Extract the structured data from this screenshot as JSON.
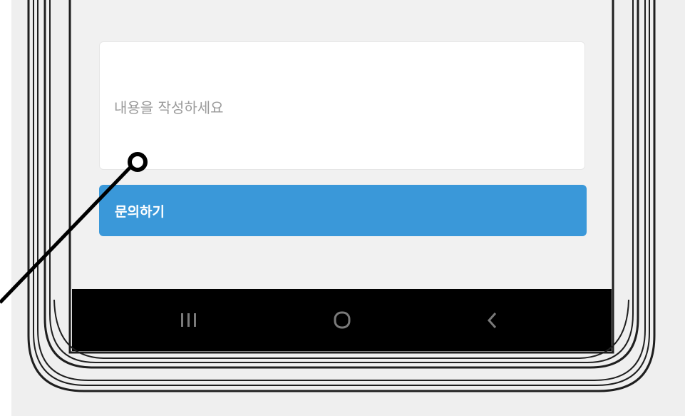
{
  "form": {
    "content_placeholder": "내용을 작성하세요",
    "content_value": "",
    "submit_label": "문의하기"
  },
  "navbar": {
    "recents_icon": "recents-icon",
    "home_icon": "home-icon",
    "back_icon": "back-icon"
  },
  "colors": {
    "accent": "#3a98d9",
    "screen_bg": "#f1f1f1",
    "navbar_bg": "#000000"
  }
}
